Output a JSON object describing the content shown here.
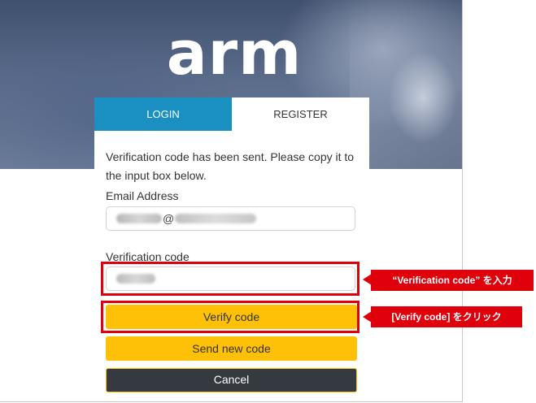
{
  "brand": {
    "logo_text": "arm"
  },
  "tabs": [
    {
      "label": "LOGIN",
      "active": true
    },
    {
      "label": "REGISTER",
      "active": false
    }
  ],
  "message": "Verification code has been sent. Please copy it to the input box below.",
  "email": {
    "label": "Email Address",
    "value_visible_char": "@"
  },
  "verification": {
    "label": "Verification code"
  },
  "buttons": {
    "verify": "Verify code",
    "send_new": "Send new code",
    "cancel": "Cancel"
  },
  "annotations": [
    {
      "text": "“Verification  code” を入力"
    },
    {
      "text": "[Verify  code] をクリック"
    }
  ],
  "colors": {
    "tab_active": "#1a8fc2",
    "button_primary": "#ffc107",
    "button_cancel": "#343a40",
    "annotation_red": "#e0000b"
  }
}
